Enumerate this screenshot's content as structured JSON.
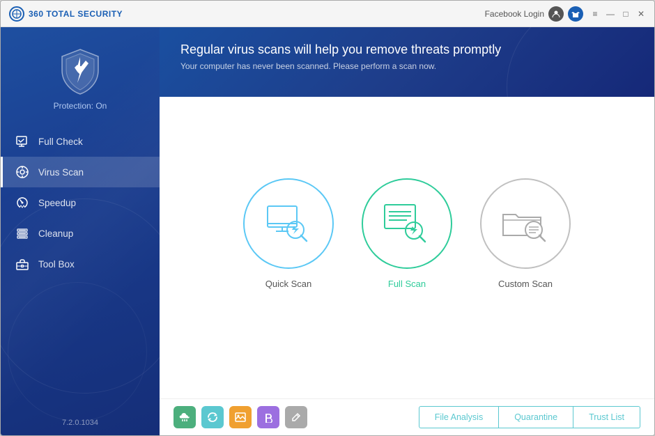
{
  "app": {
    "title": "360 TOTAL SECURITY",
    "version": "7.2.0.1034"
  },
  "titlebar": {
    "facebook_login": "Facebook Login",
    "minimize": "—",
    "maximize": "□",
    "close": "✕"
  },
  "sidebar": {
    "protection_label": "Protection: On",
    "nav_items": [
      {
        "id": "full-check",
        "label": "Full Check",
        "active": false
      },
      {
        "id": "virus-scan",
        "label": "Virus Scan",
        "active": true
      },
      {
        "id": "speedup",
        "label": "Speedup",
        "active": false
      },
      {
        "id": "cleanup",
        "label": "Cleanup",
        "active": false
      },
      {
        "id": "toolbox",
        "label": "Tool Box",
        "active": false
      }
    ]
  },
  "banner": {
    "title": "Regular virus scans will help you remove threats promptly",
    "subtitle": "Your computer has never been scanned. Please perform a scan now."
  },
  "scan_options": [
    {
      "id": "quick",
      "label": "Quick Scan",
      "color": "blue",
      "label_class": ""
    },
    {
      "id": "full",
      "label": "Full Scan",
      "color": "green",
      "label_class": "green-text"
    },
    {
      "id": "custom",
      "label": "Custom Scan",
      "color": "gray",
      "label_class": ""
    }
  ],
  "bottom_actions": [
    {
      "id": "file-analysis",
      "label": "File Analysis"
    },
    {
      "id": "quarantine",
      "label": "Quarantine"
    },
    {
      "id": "trust-list",
      "label": "Trust List"
    }
  ],
  "tool_icons": [
    {
      "id": "cloud",
      "char": "☁",
      "bg": "green-bg"
    },
    {
      "id": "refresh",
      "char": "↻",
      "bg": "teal-bg"
    },
    {
      "id": "image",
      "char": "🖼",
      "bg": "orange-bg"
    },
    {
      "id": "bold",
      "char": "B",
      "bg": "purple-bg"
    },
    {
      "id": "edit",
      "char": "✎",
      "bg": "gray-bg"
    }
  ]
}
